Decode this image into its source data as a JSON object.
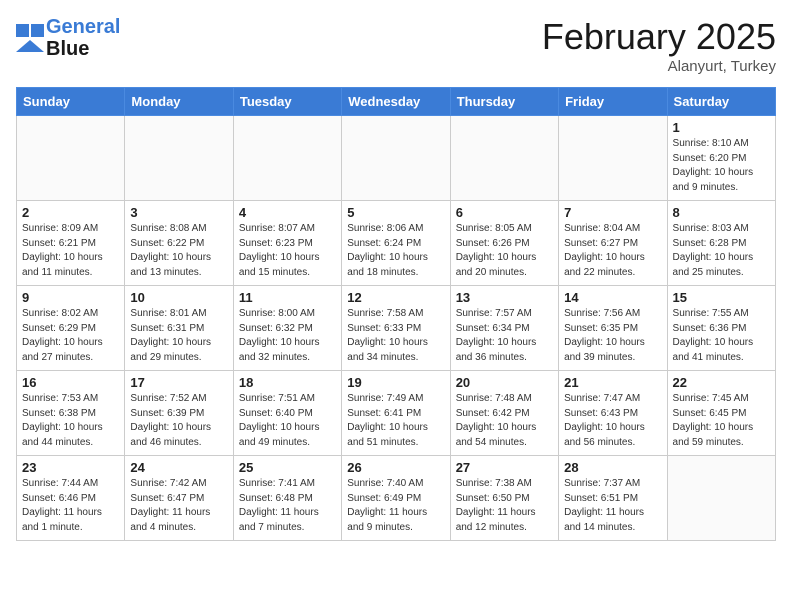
{
  "logo": {
    "line1": "General",
    "line2": "Blue"
  },
  "title": "February 2025",
  "subtitle": "Alanyurt, Turkey",
  "days_of_week": [
    "Sunday",
    "Monday",
    "Tuesday",
    "Wednesday",
    "Thursday",
    "Friday",
    "Saturday"
  ],
  "weeks": [
    [
      {
        "day": "",
        "info": ""
      },
      {
        "day": "",
        "info": ""
      },
      {
        "day": "",
        "info": ""
      },
      {
        "day": "",
        "info": ""
      },
      {
        "day": "",
        "info": ""
      },
      {
        "day": "",
        "info": ""
      },
      {
        "day": "1",
        "info": "Sunrise: 8:10 AM\nSunset: 6:20 PM\nDaylight: 10 hours\nand 9 minutes."
      }
    ],
    [
      {
        "day": "2",
        "info": "Sunrise: 8:09 AM\nSunset: 6:21 PM\nDaylight: 10 hours\nand 11 minutes."
      },
      {
        "day": "3",
        "info": "Sunrise: 8:08 AM\nSunset: 6:22 PM\nDaylight: 10 hours\nand 13 minutes."
      },
      {
        "day": "4",
        "info": "Sunrise: 8:07 AM\nSunset: 6:23 PM\nDaylight: 10 hours\nand 15 minutes."
      },
      {
        "day": "5",
        "info": "Sunrise: 8:06 AM\nSunset: 6:24 PM\nDaylight: 10 hours\nand 18 minutes."
      },
      {
        "day": "6",
        "info": "Sunrise: 8:05 AM\nSunset: 6:26 PM\nDaylight: 10 hours\nand 20 minutes."
      },
      {
        "day": "7",
        "info": "Sunrise: 8:04 AM\nSunset: 6:27 PM\nDaylight: 10 hours\nand 22 minutes."
      },
      {
        "day": "8",
        "info": "Sunrise: 8:03 AM\nSunset: 6:28 PM\nDaylight: 10 hours\nand 25 minutes."
      }
    ],
    [
      {
        "day": "9",
        "info": "Sunrise: 8:02 AM\nSunset: 6:29 PM\nDaylight: 10 hours\nand 27 minutes."
      },
      {
        "day": "10",
        "info": "Sunrise: 8:01 AM\nSunset: 6:31 PM\nDaylight: 10 hours\nand 29 minutes."
      },
      {
        "day": "11",
        "info": "Sunrise: 8:00 AM\nSunset: 6:32 PM\nDaylight: 10 hours\nand 32 minutes."
      },
      {
        "day": "12",
        "info": "Sunrise: 7:58 AM\nSunset: 6:33 PM\nDaylight: 10 hours\nand 34 minutes."
      },
      {
        "day": "13",
        "info": "Sunrise: 7:57 AM\nSunset: 6:34 PM\nDaylight: 10 hours\nand 36 minutes."
      },
      {
        "day": "14",
        "info": "Sunrise: 7:56 AM\nSunset: 6:35 PM\nDaylight: 10 hours\nand 39 minutes."
      },
      {
        "day": "15",
        "info": "Sunrise: 7:55 AM\nSunset: 6:36 PM\nDaylight: 10 hours\nand 41 minutes."
      }
    ],
    [
      {
        "day": "16",
        "info": "Sunrise: 7:53 AM\nSunset: 6:38 PM\nDaylight: 10 hours\nand 44 minutes."
      },
      {
        "day": "17",
        "info": "Sunrise: 7:52 AM\nSunset: 6:39 PM\nDaylight: 10 hours\nand 46 minutes."
      },
      {
        "day": "18",
        "info": "Sunrise: 7:51 AM\nSunset: 6:40 PM\nDaylight: 10 hours\nand 49 minutes."
      },
      {
        "day": "19",
        "info": "Sunrise: 7:49 AM\nSunset: 6:41 PM\nDaylight: 10 hours\nand 51 minutes."
      },
      {
        "day": "20",
        "info": "Sunrise: 7:48 AM\nSunset: 6:42 PM\nDaylight: 10 hours\nand 54 minutes."
      },
      {
        "day": "21",
        "info": "Sunrise: 7:47 AM\nSunset: 6:43 PM\nDaylight: 10 hours\nand 56 minutes."
      },
      {
        "day": "22",
        "info": "Sunrise: 7:45 AM\nSunset: 6:45 PM\nDaylight: 10 hours\nand 59 minutes."
      }
    ],
    [
      {
        "day": "23",
        "info": "Sunrise: 7:44 AM\nSunset: 6:46 PM\nDaylight: 11 hours\nand 1 minute."
      },
      {
        "day": "24",
        "info": "Sunrise: 7:42 AM\nSunset: 6:47 PM\nDaylight: 11 hours\nand 4 minutes."
      },
      {
        "day": "25",
        "info": "Sunrise: 7:41 AM\nSunset: 6:48 PM\nDaylight: 11 hours\nand 7 minutes."
      },
      {
        "day": "26",
        "info": "Sunrise: 7:40 AM\nSunset: 6:49 PM\nDaylight: 11 hours\nand 9 minutes."
      },
      {
        "day": "27",
        "info": "Sunrise: 7:38 AM\nSunset: 6:50 PM\nDaylight: 11 hours\nand 12 minutes."
      },
      {
        "day": "28",
        "info": "Sunrise: 7:37 AM\nSunset: 6:51 PM\nDaylight: 11 hours\nand 14 minutes."
      },
      {
        "day": "",
        "info": ""
      }
    ]
  ]
}
